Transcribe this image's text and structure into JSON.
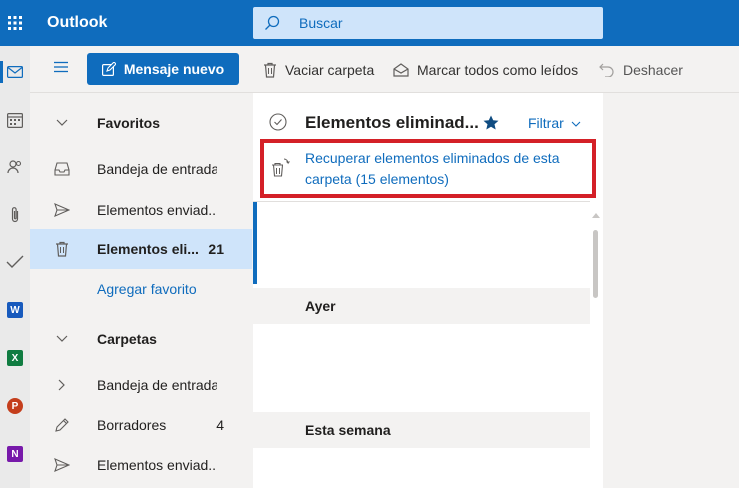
{
  "app": {
    "title": "Outlook"
  },
  "search": {
    "placeholder": "Buscar"
  },
  "toolbar": {
    "new_message_label": "Mensaje nuevo",
    "empty_folder_label": "Vaciar carpeta",
    "mark_all_read_label": "Marcar todos como leídos",
    "undo_label": "Deshacer"
  },
  "rail": {
    "icons": [
      "mail-icon",
      "calendar-icon",
      "people-icon",
      "attach-icon",
      "todo-icon",
      "word-icon",
      "excel-icon",
      "powerpoint-icon",
      "onenote-icon"
    ],
    "word_letter": "W",
    "excel_letter": "X",
    "powerpoint_letter": "P",
    "onenote_letter": "N"
  },
  "nav": {
    "favorites_label": "Favoritos",
    "fav_inbox": "Bandeja de entrada",
    "fav_sent": "Elementos enviad...",
    "fav_deleted": "Elementos eli...",
    "fav_deleted_count": "21",
    "add_favorite": "Agregar favorito",
    "folders_label": "Carpetas",
    "folder_inbox": "Bandeja de entrada",
    "folder_drafts": "Borradores",
    "folder_drafts_count": "4",
    "folder_sent": "Elementos enviad..."
  },
  "list": {
    "title": "Elementos eliminad...",
    "filter_label": "Filtrar",
    "recover_text": "Recuperar elementos eliminados de esta carpeta (15 elementos)",
    "group_yesterday": "Ayer",
    "group_this_week": "Esta semana"
  },
  "colors": {
    "brand": "#0f6cbd",
    "highlight_border": "#d42027",
    "selected_nav": "#cfe4fa"
  }
}
